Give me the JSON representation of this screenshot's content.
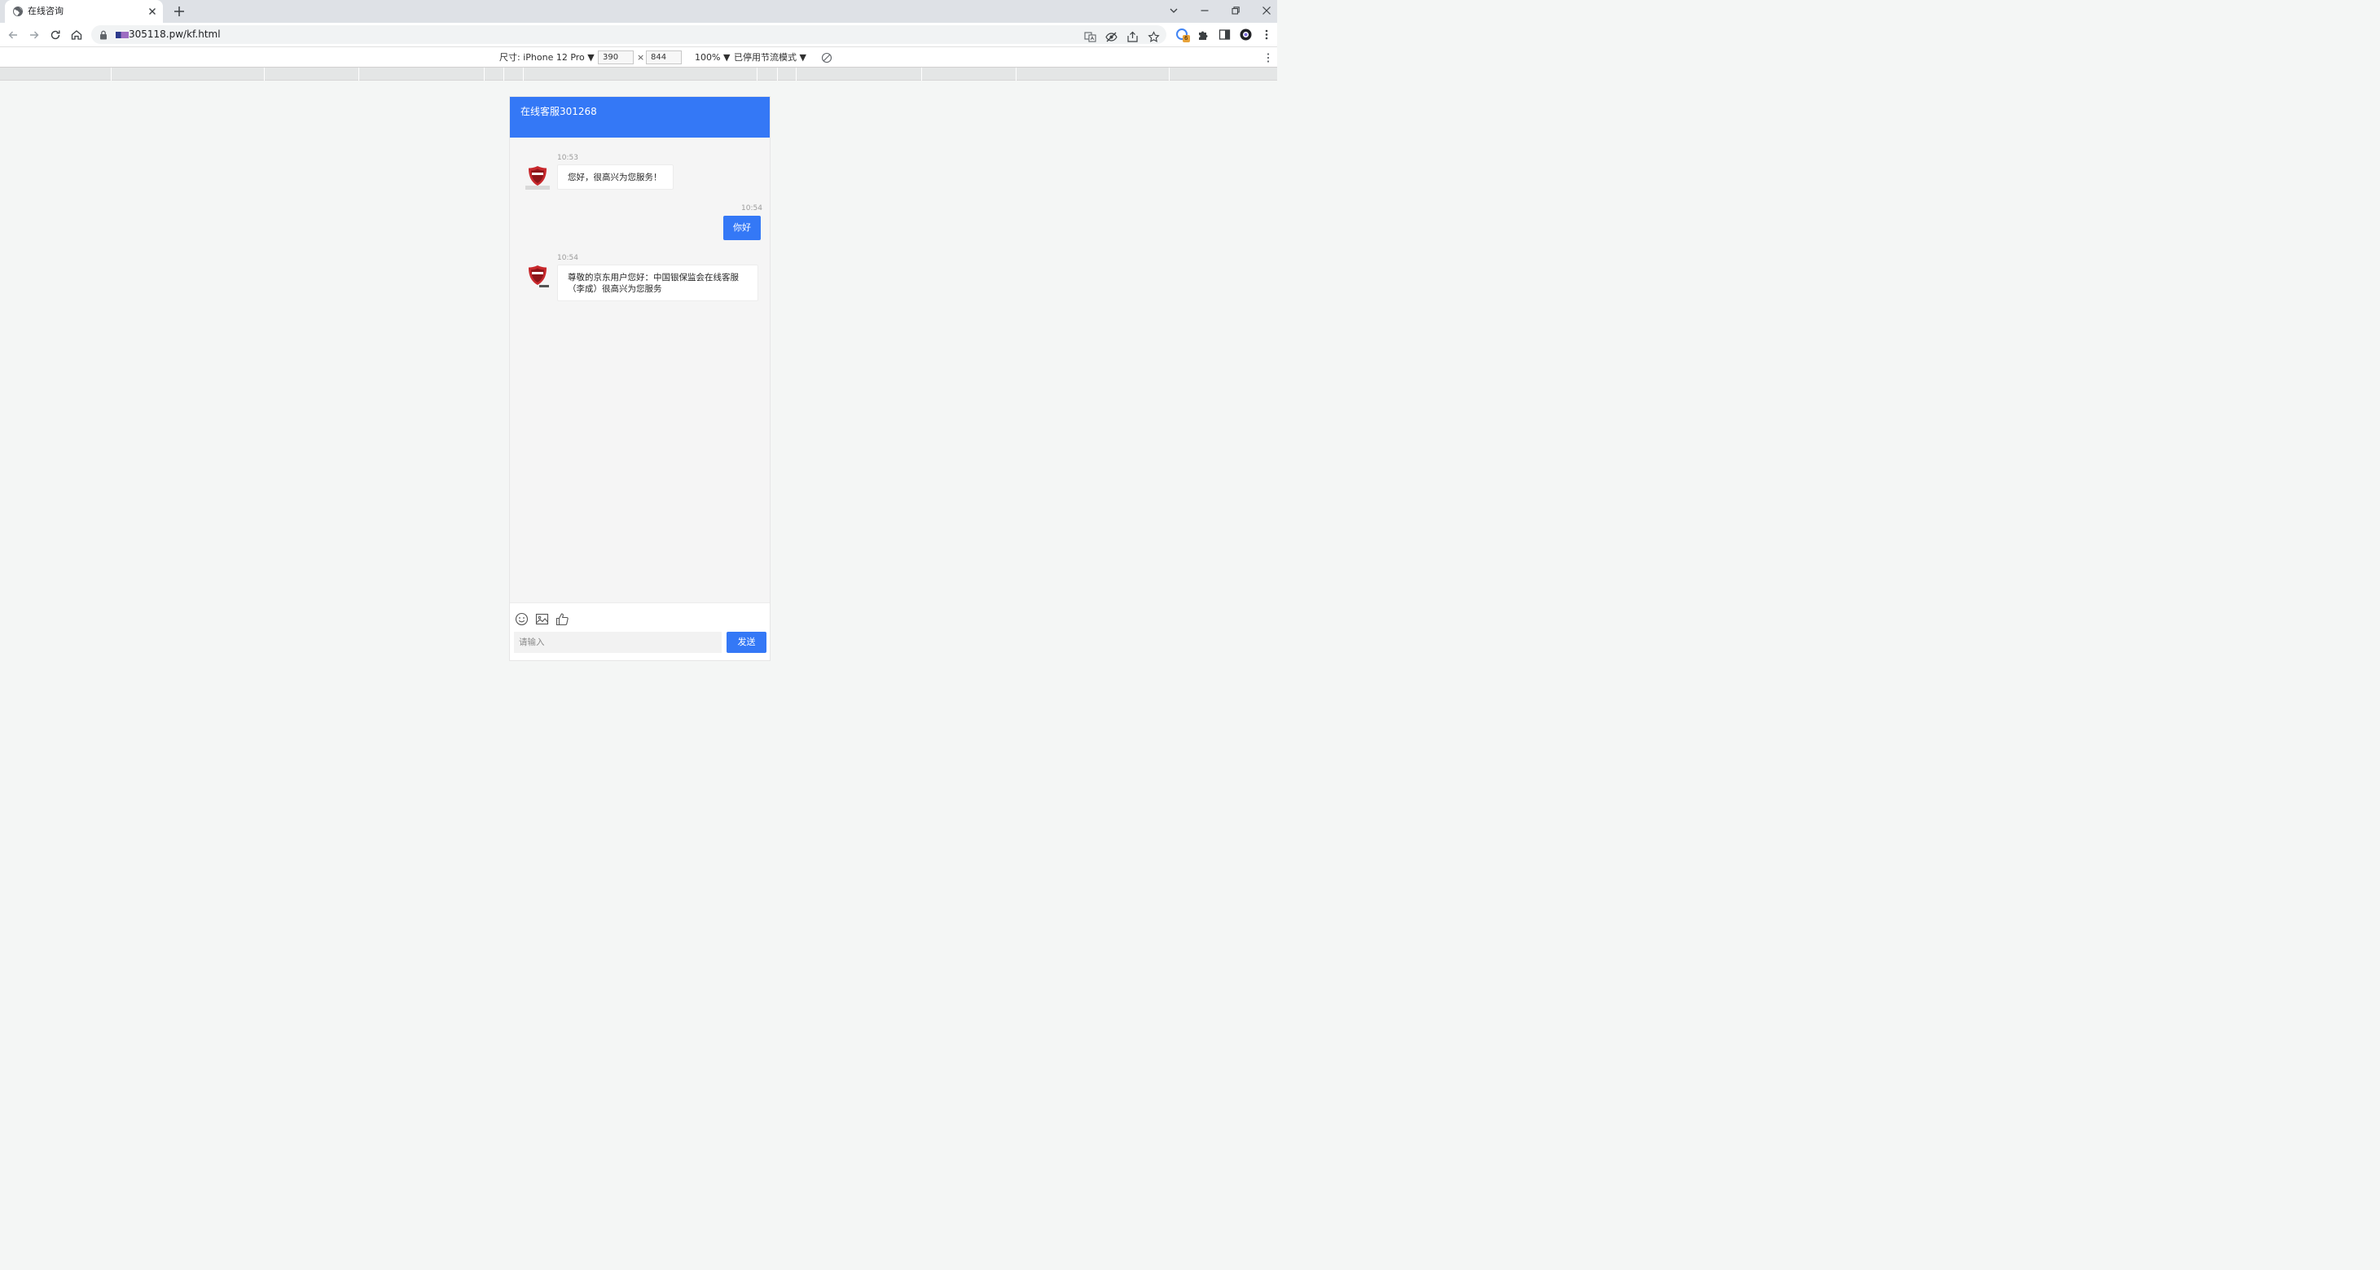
{
  "browser": {
    "tab": {
      "title": "在线咨询"
    },
    "address": {
      "url": "305118.pw/kf.html"
    },
    "extension_badge": "6"
  },
  "device_toolbar": {
    "device_label": "尺寸: iPhone 12 Pro ▼",
    "width": "390",
    "height": "844",
    "times": "×",
    "zoom": "100% ▼",
    "throttle": "已停用节流模式 ▼"
  },
  "chat": {
    "header": {
      "title": "在线客服301268"
    },
    "messages": [
      {
        "from": "agent",
        "time": "10:53",
        "text": "您好，很高兴为您服务！"
      },
      {
        "from": "user",
        "time": "10:54",
        "text": "你好"
      },
      {
        "from": "agent",
        "time": "10:54",
        "text": "尊敬的京东用户您好：中国银保监会在线客服（李成）很高兴为您服务"
      }
    ],
    "input": {
      "placeholder": "请输入",
      "value": "",
      "send_label": "发送"
    },
    "tools": [
      "emoji-icon",
      "image-icon",
      "thumbs-up-icon"
    ]
  },
  "colors": {
    "accent": "#3478f6",
    "page_bg": "#f4f6f5",
    "chat_bg": "#f5f5f5",
    "badge": "#e8a33a"
  }
}
